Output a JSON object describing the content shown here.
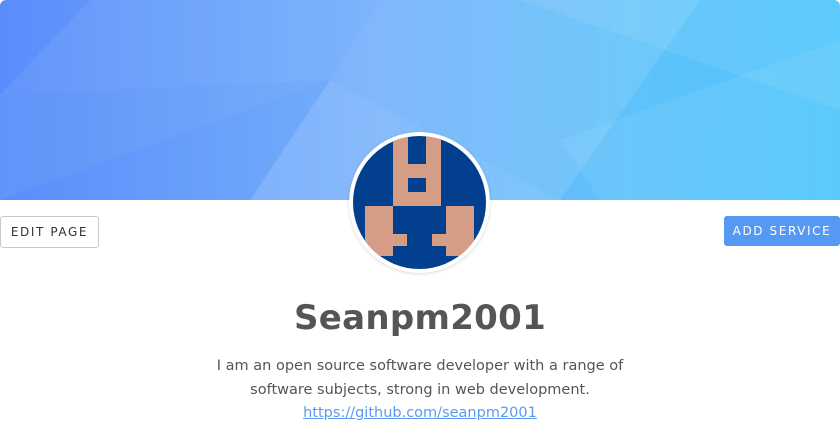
{
  "header": {
    "edit_button_label": "EDIT PAGE",
    "add_service_button_label": "ADD SERVICE"
  },
  "profile": {
    "username": "Seanpm2001",
    "bio_line_1": "I am an open source software developer with a range of",
    "bio_line_2": "software subjects, strong in web development.",
    "link_text": "https://github.com/seanpm2001",
    "avatar_icon": "identicon-avatar"
  },
  "colors": {
    "banner_start": "#5a8dfb",
    "banner_end": "#4fc6fb",
    "accent": "#5599f5",
    "avatar_bg": "#033f8f",
    "avatar_fg": "#d59c86",
    "text": "#555555",
    "link": "#5b9af0"
  }
}
